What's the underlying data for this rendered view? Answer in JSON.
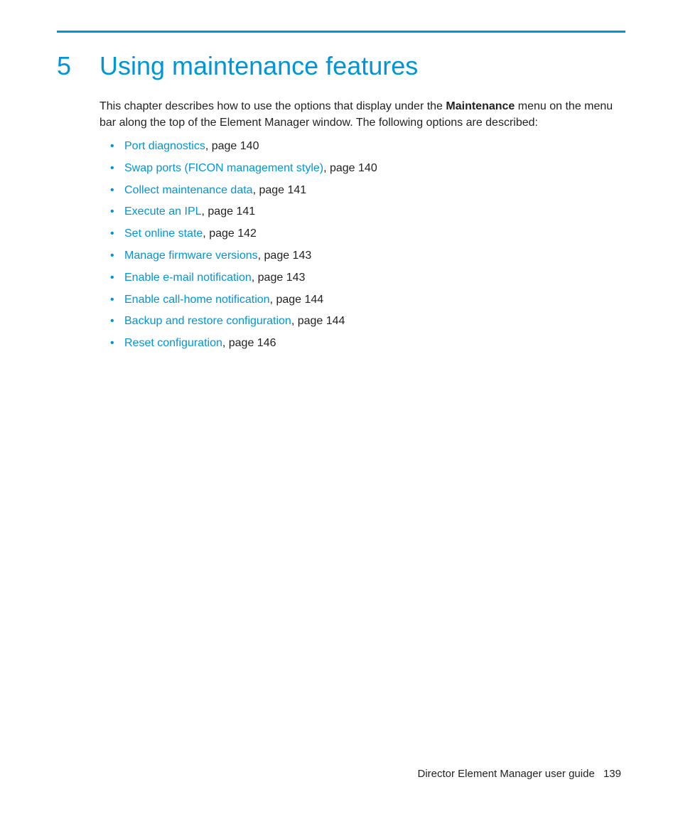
{
  "chapter": {
    "number": "5",
    "title": "Using maintenance features"
  },
  "intro": {
    "prefix": "This chapter describes how to use the options that display under the ",
    "strong": "Maintenance",
    "suffix": " menu on the menu bar along the top of the Element Manager window. The following options are described:"
  },
  "toc": [
    {
      "link": "Port diagnostics",
      "suffix": ", page 140"
    },
    {
      "link": "Swap ports (FICON management style)",
      "suffix": ", page 140"
    },
    {
      "link": "Collect maintenance data",
      "suffix": ", page 141"
    },
    {
      "link": "Execute an IPL",
      "suffix": ", page 141"
    },
    {
      "link": "Set online state",
      "suffix": ", page 142"
    },
    {
      "link": "Manage firmware versions",
      "suffix": ", page 143"
    },
    {
      "link": "Enable e-mail notification",
      "suffix": ", page 143"
    },
    {
      "link": "Enable call-home notification",
      "suffix": ", page 144"
    },
    {
      "link": "Backup and restore configuration",
      "suffix": ", page 144"
    },
    {
      "link": "Reset configuration",
      "suffix": ", page 146"
    }
  ],
  "footer": {
    "title": "Director Element Manager user guide",
    "page": "139"
  }
}
